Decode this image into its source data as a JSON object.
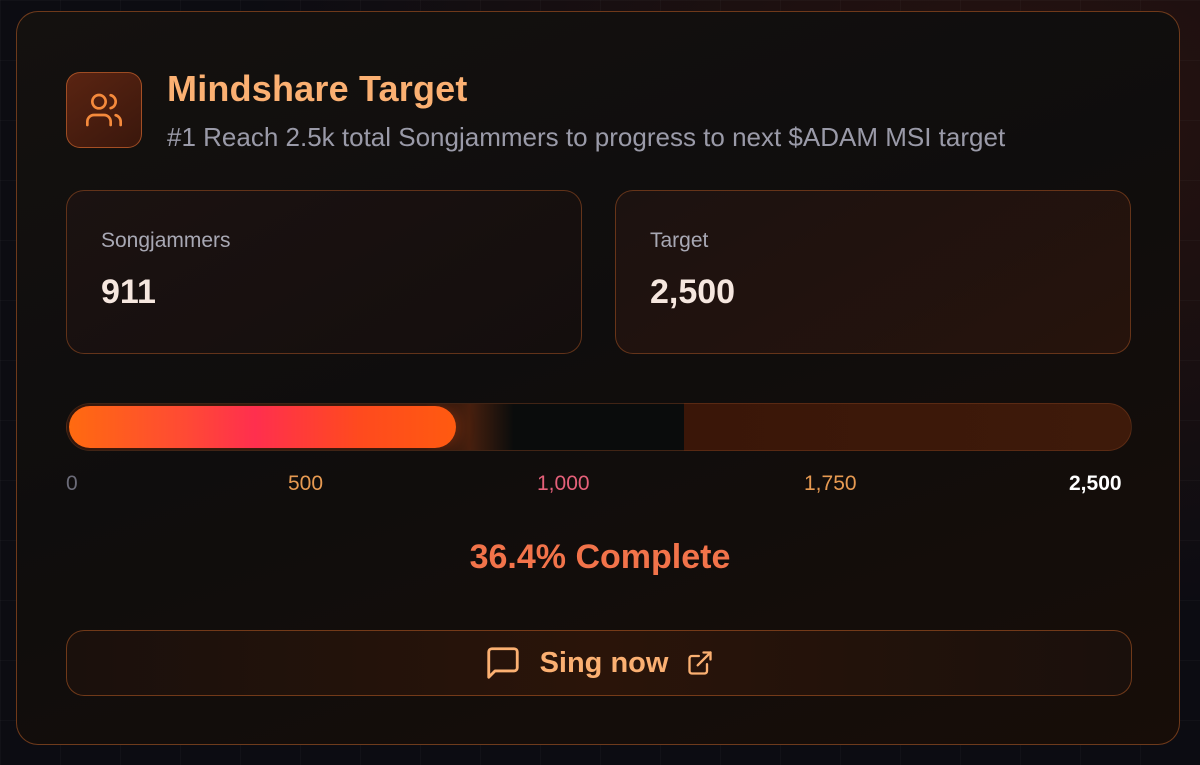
{
  "header": {
    "icon": "users-icon",
    "title": "Mindshare Target",
    "subtitle": "#1 Reach 2.5k total Songjammers to progress to next $ADAM MSI target"
  },
  "stats": {
    "current": {
      "label": "Songjammers",
      "value": "911"
    },
    "target": {
      "label": "Target",
      "value": "2,500"
    }
  },
  "progress": {
    "current": 911,
    "max": 2500,
    "fraction": 0.364,
    "ticks": [
      "0",
      "500",
      "1,000",
      "1,750",
      "2,500"
    ],
    "tick_colors": [
      "#6b6b78",
      "#e79a52",
      "#e5607a",
      "#e79a52",
      "#ffffff"
    ],
    "status": "36.4% Complete"
  },
  "action": {
    "label": "Sing now",
    "icon": "message-square-icon",
    "trailing_icon": "external-link-icon"
  },
  "colors": {
    "accent": "#fbb072",
    "complete": "#f2734a"
  }
}
